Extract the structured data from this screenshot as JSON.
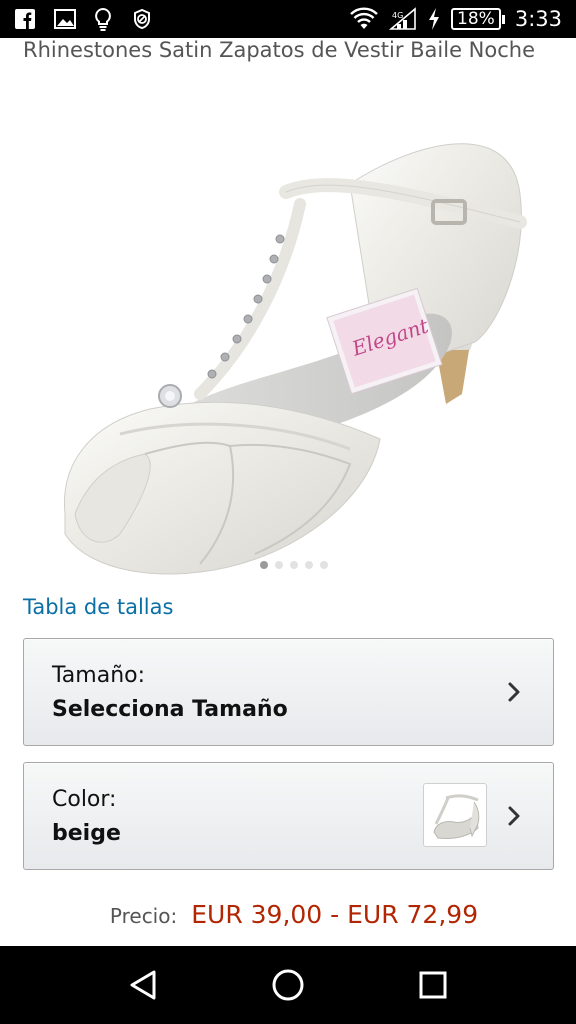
{
  "status_bar": {
    "left_icons": [
      "facebook-icon",
      "gallery-icon",
      "lightbulb-icon",
      "blocked-icon"
    ],
    "battery_percent": "18%",
    "time": "3:33"
  },
  "product": {
    "title": "Rhinestones Satin Zapatos de Vestir Baile Noche",
    "image_count": 5,
    "active_image_index": 0,
    "image_brand_lettering": "Elegant"
  },
  "size_chart_link": "Tabla de tallas",
  "size_selector": {
    "label": "Tamaño:",
    "value": "Selecciona Tamaño"
  },
  "color_selector": {
    "label": "Color:",
    "value": "beige"
  },
  "price": {
    "label": "Precio:",
    "value": "EUR 39,00 - EUR 72,99"
  },
  "colors": {
    "link": "#0a6fa5",
    "price": "#b12704",
    "selector_border": "#a8a8a8"
  },
  "nav_bar": {
    "buttons": [
      "back-icon",
      "home-icon",
      "recents-icon"
    ]
  }
}
